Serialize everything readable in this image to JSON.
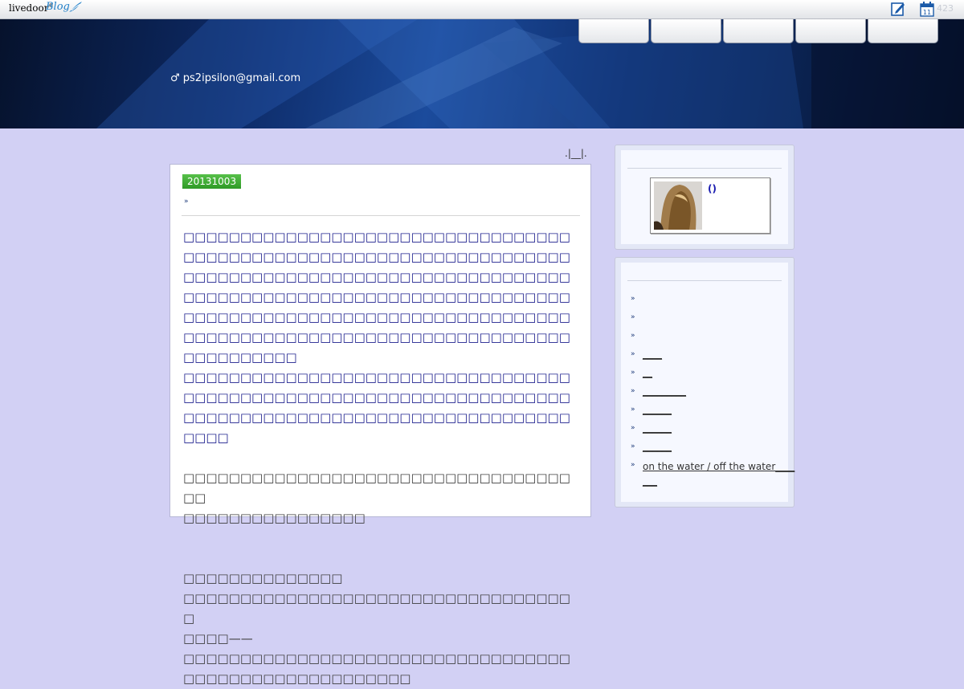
{
  "topbar": {
    "logo_text": "livedoor",
    "logo_sup": "®",
    "logo_blog": "Blog",
    "calendar_day": "11",
    "calendar_count": "423"
  },
  "header": {
    "email": "♂ ps2ipsilon@gmail.com",
    "nav_items": [
      "",
      "",
      "",
      "",
      ""
    ]
  },
  "breadcrumb": ".|__|.",
  "article": {
    "date": "20131003",
    "category_bullet": "»",
    "paragraphs": [
      {
        "style": "blue",
        "lines": [
          "□□□□□□□□□□□□□□□□□□□□□□□□□□□□□□□□□□□□□□□□□□□□□□□□□□□□□□□□□□□□□□□□□□□□□□□□□□□□□□□□□□□□□□□□□□□□□□□□□□□□□□□□□□□□□□□□□□□□□□□□□□□□□□□□□□□□□□□□□□□□□□□□□□□□□□□□□□□□□□□□□□□□□□□□□□□□□□□□□□□□□□□□□□□□□□□□□□□□□□□□□□□□□□□□□□□□□□"
        ]
      },
      {
        "style": "blue",
        "lines": [
          "□□□□□□□□□□□□□□□□□□□□□□□□□□□□□□□□□□□□□□□□□□□□□□□□□□□□□□□□□□□□□□□□□□□□□□□□□□□□□□□□□□□□□□□□□□□□□□□□□□□□□□□□□□"
        ]
      },
      {
        "style": "dark",
        "lines": [
          "",
          "□□□□□□□□□□□□□□□□□□□□□□□□□□□□□□□□□□□□",
          "□□□□□□□□□□□□□□□□",
          "",
          "",
          "□□□□□□□□□□□□□□",
          "□□□□□□□□□□□□□□□□□□□□□□□□□□□□□□□□□□□",
          "□□□□——",
          "□□□□□□□□□□□□□□□□□□□□□□□□□□□□□□□□□□□□□□□□□□□□□□□□□□□□□□"
        ]
      }
    ]
  },
  "sidebar": {
    "profile_name": "()",
    "links": [
      "",
      "",
      "",
      "____",
      "__",
      "_________",
      "______",
      "______",
      "______",
      " on the water / off the water_______"
    ]
  }
}
